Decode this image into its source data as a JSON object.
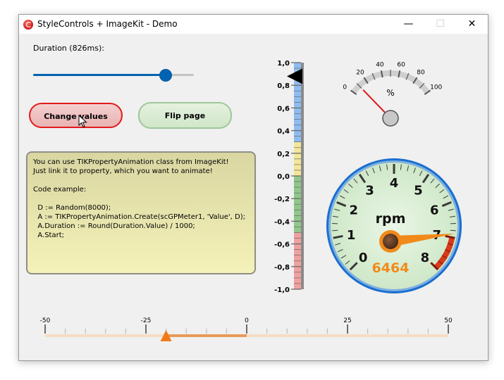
{
  "window": {
    "title": "StyleControls + ImageKit  - Demo",
    "controls": {
      "minimize": "—",
      "maximize": "☐",
      "close": "✕"
    }
  },
  "duration": {
    "label": "Duration (826ms):",
    "slider_fraction": 0.82
  },
  "buttons": {
    "change_label": "Change values",
    "flip_label": "Flip page"
  },
  "memo": {
    "lines": [
      "You can use TIKPropertyAnimation class from ImageKit!",
      "Just link it to property, which you want to animate!",
      "",
      "Code example:",
      "",
      "  D := Random(8000);",
      "  A := TIKPropertyAnimation.Create(scGPMeter1, 'Value', D);",
      "  A.Duration := Round(Duration.Value) / 1000;",
      "  A.Start;"
    ]
  },
  "vertical_scale": {
    "min": -1.0,
    "max": 1.0,
    "value": 0.88,
    "labels": [
      "1,0",
      "0,8",
      "0,6",
      "0,4",
      "0,2",
      "0,0",
      "-0,2",
      "-0,4",
      "-0,6",
      "-0,8",
      "-1,0"
    ],
    "zones": [
      {
        "from": 0.3,
        "to": 1.0,
        "color": "#8fbcf0"
      },
      {
        "from": 0.0,
        "to": 0.3,
        "color": "#f2e79a"
      },
      {
        "from": -0.5,
        "to": 0.0,
        "color": "#8ec88a"
      },
      {
        "from": -1.0,
        "to": -0.5,
        "color": "#f0a0a0"
      }
    ]
  },
  "percent_gauge": {
    "unit": "%",
    "min": 0,
    "max": 100,
    "value": 10,
    "labels": [
      "0",
      "20",
      "40",
      "60",
      "80",
      "100"
    ]
  },
  "rpm_gauge": {
    "unit": "rpm",
    "min": 0,
    "max": 8,
    "value": 6.464,
    "readout": "6464",
    "labels": [
      "0",
      "1",
      "2",
      "3",
      "4",
      "5",
      "6",
      "7",
      "8"
    ],
    "redline_from": 7
  },
  "horizontal_scale": {
    "min": -50,
    "max": 50,
    "value": -20,
    "labels": [
      "-50",
      "-25",
      "0",
      "25",
      "50"
    ]
  },
  "colors": {
    "accent_blue": "#0063b1",
    "rpm_orange": "#f08a1a",
    "red_button_border": "#e21b1b",
    "green_button_border": "#9ec79a",
    "needle_red": "#e01818"
  }
}
